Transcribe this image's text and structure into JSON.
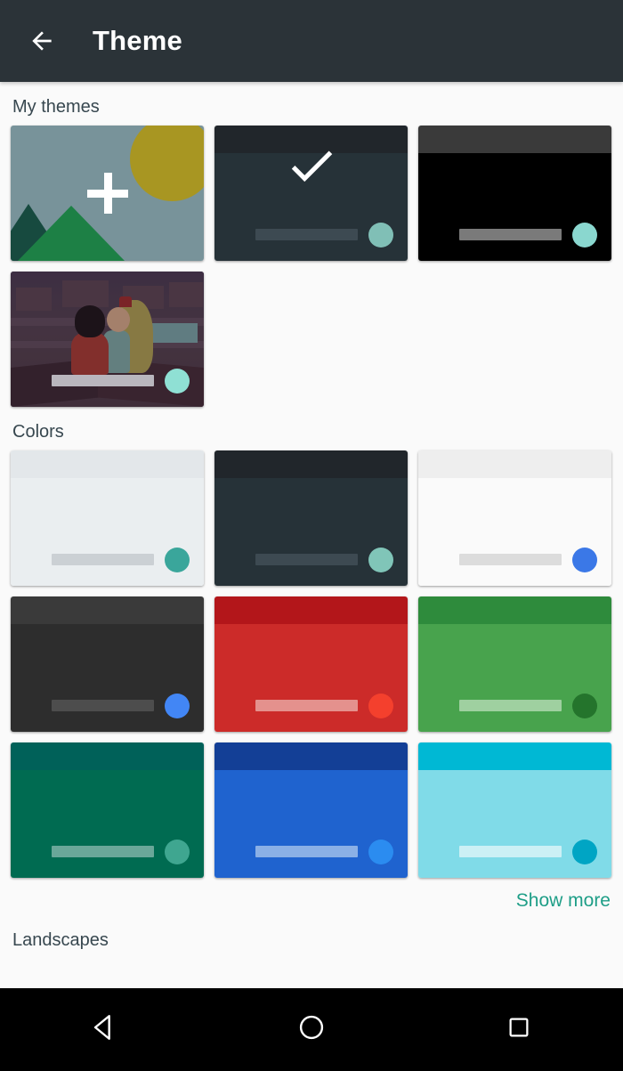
{
  "appbar": {
    "title": "Theme",
    "back_icon": "arrow-left-icon",
    "background": "#2b3338"
  },
  "sections": [
    {
      "id": "my-themes",
      "label": "My themes"
    },
    {
      "id": "colors",
      "label": "Colors"
    },
    {
      "id": "landscapes",
      "label": "Landscapes"
    }
  ],
  "my_themes": [
    {
      "name": "add-new-theme",
      "kind": "add",
      "selected": false,
      "sky": "#78939a",
      "sun": "#a89622",
      "mountain_front": "#1d8045",
      "mountain_back": "#174a3f",
      "plus": "#ffffff"
    },
    {
      "name": "dark-theme",
      "kind": "color",
      "selected": true,
      "header": "#21262b",
      "body": "#263238",
      "bar": "#3d4a52",
      "fab": "#80bfb6",
      "check": "#ffffff"
    },
    {
      "name": "black-theme",
      "kind": "color",
      "selected": false,
      "header": "#3a3a3a",
      "body": "#000000",
      "bar": "#7a7a7a",
      "fab": "#8ad7cf"
    },
    {
      "name": "illustration-theme",
      "kind": "image",
      "selected": false,
      "bar": "#b9b6bd",
      "fab": "#8fe0d4"
    }
  ],
  "colors": [
    {
      "name": "color-light-grey",
      "header": "#e3e7ea",
      "body": "#eaeef0",
      "bar": "#cbd0d4",
      "fab": "#3aa69b"
    },
    {
      "name": "color-dark-slate",
      "header": "#21262b",
      "body": "#263238",
      "bar": "#3d4a52",
      "fab": "#80c5b8"
    },
    {
      "name": "color-white",
      "header": "#eeeeee",
      "body": "#fafafa",
      "bar": "#dcdcdc",
      "fab": "#3b78e7"
    },
    {
      "name": "color-black-grey",
      "header": "#3a3a3a",
      "body": "#2d2d2d",
      "bar": "#4d4d4d",
      "fab": "#4286f5"
    },
    {
      "name": "color-red",
      "header": "#b3161a",
      "body": "#cc2b29",
      "bar": "#e4918d",
      "fab": "#f4402d"
    },
    {
      "name": "color-green",
      "header": "#2e8b3c",
      "body": "#48a34d",
      "bar": "#9fd0a0",
      "fab": "#24742c"
    },
    {
      "name": "color-teal-dark",
      "header": "#006159",
      "body": "#006b51",
      "bar": "#6aa799",
      "fab": "#3fa690"
    },
    {
      "name": "color-blue",
      "header": "#133f96",
      "body": "#1f63cf",
      "bar": "#8ab0e6",
      "fab": "#2b8cf0"
    },
    {
      "name": "color-cyan",
      "header": "#00b8d4",
      "body": "#80dbe8",
      "bar": "#ccf0f5",
      "fab": "#00a5c4"
    }
  ],
  "show_more": {
    "label": "Show more",
    "color": "#1e9e87"
  },
  "navbar": {
    "back_label": "back-triangle-icon",
    "home_label": "home-circle-icon",
    "recents_label": "recents-square-icon"
  }
}
